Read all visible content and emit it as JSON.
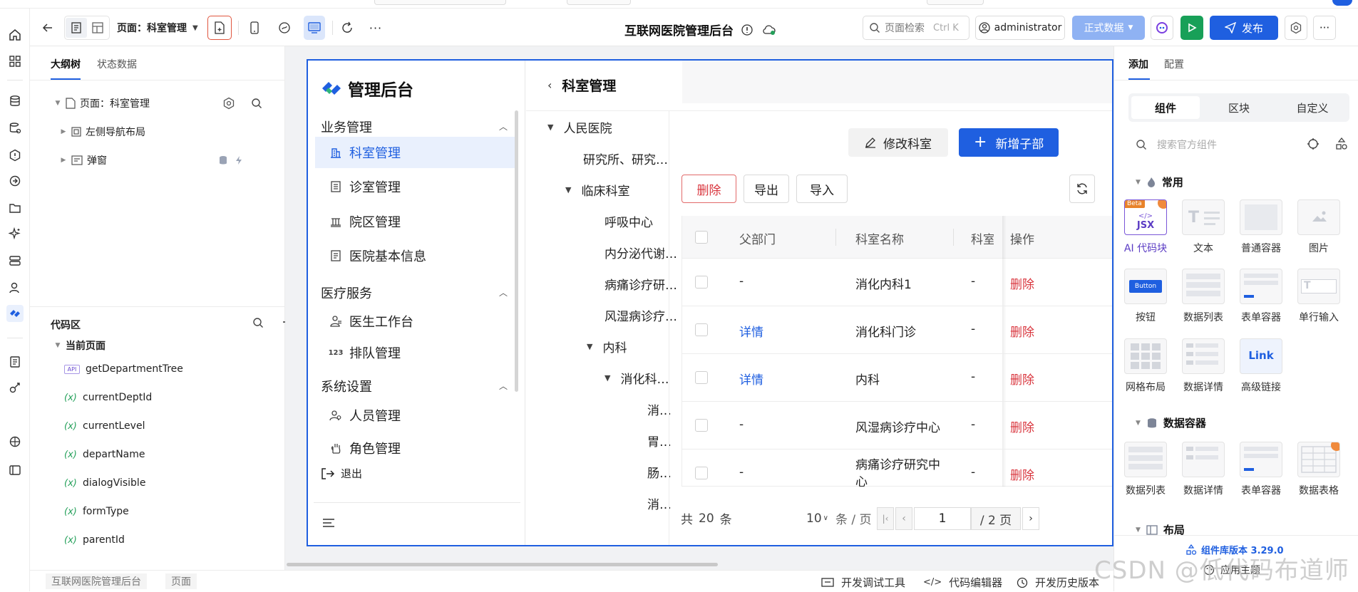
{
  "toolbar": {
    "page_selector": "页面：科室管理",
    "app_title": "互联网医院管理后台",
    "search_placeholder": "页面检索",
    "search_shortcut": "Ctrl K",
    "user": "administrator",
    "env": "正式数据",
    "publish": "发布"
  },
  "outline": {
    "tabs": [
      "大纲树",
      "状态数据"
    ],
    "nodes": [
      "页面：科室管理",
      "左侧导航布局",
      "弹窗"
    ]
  },
  "code": {
    "title": "代码区",
    "group": "当前页面",
    "items": [
      {
        "kind": "API",
        "name": "getDepartmentTree"
      },
      {
        "kind": "(x)",
        "name": "currentDeptId"
      },
      {
        "kind": "(x)",
        "name": "currentLevel"
      },
      {
        "kind": "(x)",
        "name": "departName"
      },
      {
        "kind": "(x)",
        "name": "dialogVisible"
      },
      {
        "kind": "(x)",
        "name": "formType"
      },
      {
        "kind": "(x)",
        "name": "parentId"
      }
    ]
  },
  "app": {
    "logo_text": "管理后台",
    "menu": {
      "group1": "业务管理",
      "group1_items": [
        "科室管理",
        "诊室管理",
        "院区管理",
        "医院基本信息"
      ],
      "group2": "医疗服务",
      "group2_items": [
        "医生工作台",
        "排队管理"
      ],
      "group3": "系统设置",
      "group3_items": [
        "人员管理",
        "角色管理"
      ],
      "logout": "退出"
    },
    "page_title": "科室管理",
    "tree": [
      "人民医院",
      "研究所、研究…",
      "临床科室",
      "呼吸中心",
      "内分泌代谢…",
      "病痛诊疗研…",
      "风湿病诊疗…",
      "内科",
      "消化科…",
      "消…",
      "胃…",
      "肠…",
      "消…"
    ],
    "buttons": {
      "edit": "修改科室",
      "add_child": "新增子部",
      "delete": "删除",
      "export": "导出",
      "import": "导入"
    },
    "table": {
      "headers": [
        "父部门",
        "科室名称",
        "科室",
        "操作"
      ],
      "rows": [
        {
          "parent": "-",
          "name": "消化内科1",
          "col3": "-",
          "op": "删除"
        },
        {
          "parent": "详情",
          "name": "消化科门诊",
          "col3": "-",
          "op": "删除"
        },
        {
          "parent": "详情",
          "name": "内科",
          "col3": "-",
          "op": "删除"
        },
        {
          "parent": "-",
          "name": "风湿病诊疗中心",
          "col3": "-",
          "op": "删除"
        },
        {
          "parent": "-",
          "name": "病痛诊疗研究中心",
          "col3": "-",
          "op": "删除"
        }
      ]
    },
    "pagination": {
      "total_prefix": "共",
      "total": "20",
      "total_suffix": "条",
      "page_size": "10",
      "per_page": "条 / 页",
      "current": "1",
      "pages": "/ 2 页"
    }
  },
  "right_panel": {
    "tabs": [
      "添加",
      "配置"
    ],
    "segments": [
      "组件",
      "区块",
      "自定义"
    ],
    "search_placeholder": "搜索官方组件",
    "sections": {
      "common": "常用",
      "common_items": [
        "AI 代码块",
        "文本",
        "普通容器",
        "图片",
        "按钮",
        "数据列表",
        "表单容器",
        "单行输入",
        "网格布局",
        "数据详情",
        "高级链接"
      ],
      "data": "数据容器",
      "data_items": [
        "数据列表",
        "数据详情",
        "表单容器",
        "数据表格"
      ],
      "layout": "布局"
    },
    "beta": "Beta",
    "jsx": "JSX",
    "button_thumb": "Button",
    "link_thumb": "Link",
    "version": "组件库版本 3.29.0",
    "theme": "应用主题"
  },
  "status": {
    "breadcrumb": [
      "互联网医院管理后台",
      "页面"
    ],
    "dev_tools": "开发调试工具",
    "code_editor": "代码编辑器",
    "history": "开发历史版本"
  },
  "watermark": "CSDN @低代码布道师",
  "colors": {
    "accent": "#1f5fe0",
    "danger": "#d9363e",
    "green": "#24a05a"
  }
}
